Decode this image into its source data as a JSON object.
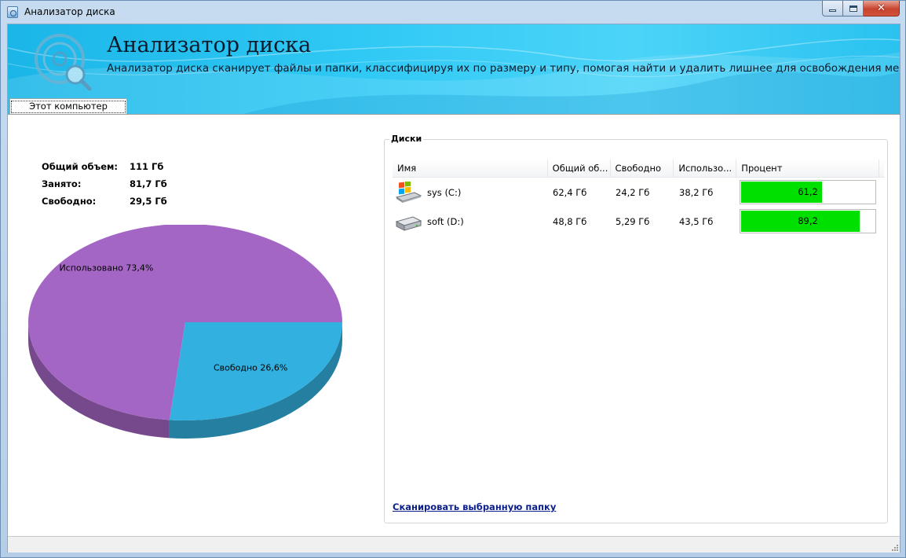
{
  "window": {
    "title": "Анализатор диска",
    "close_glyph": "✕"
  },
  "banner": {
    "title": "Анализатор диска",
    "description": "Анализатор диска сканирует файлы и папки, классифицируя их по размеру и типу, помогая найти и удалить лишнее для освобождения места."
  },
  "tabs": [
    {
      "label": "Этот компьютер",
      "selected": true
    }
  ],
  "summary": {
    "total_label": "Общий объем:",
    "total_value": "111 Гб",
    "used_label": "Занято:",
    "used_value": "81,7 Гб",
    "free_label": "Свободно:",
    "free_value": "29,5 Гб"
  },
  "chart_data": {
    "type": "pie",
    "slices": [
      {
        "label": "Использовано 73,4%",
        "value": 73.4,
        "color": "#a466c4"
      },
      {
        "label": "Свободно 26,6%",
        "value": 26.6,
        "color": "#32b0e0"
      }
    ]
  },
  "disks": {
    "title": "Диски",
    "columns": [
      "Имя",
      "Общий об...",
      "Свободно",
      "Использо...",
      "Процент"
    ],
    "rows": [
      {
        "icon": "windows-drive-icon",
        "name": "sys (C:)",
        "total": "62,4 Гб",
        "free": "24,2 Гб",
        "used": "38,2 Гб",
        "percent": 61.2,
        "percent_label": "61,2"
      },
      {
        "icon": "hard-drive-icon",
        "name": "soft (D:)",
        "total": "48,8 Гб",
        "free": "5,29 Гб",
        "used": "43,5 Гб",
        "percent": 89.2,
        "percent_label": "89,2"
      }
    ],
    "bar_color": "#00e000",
    "scan_link": "Сканировать выбранную папку"
  }
}
